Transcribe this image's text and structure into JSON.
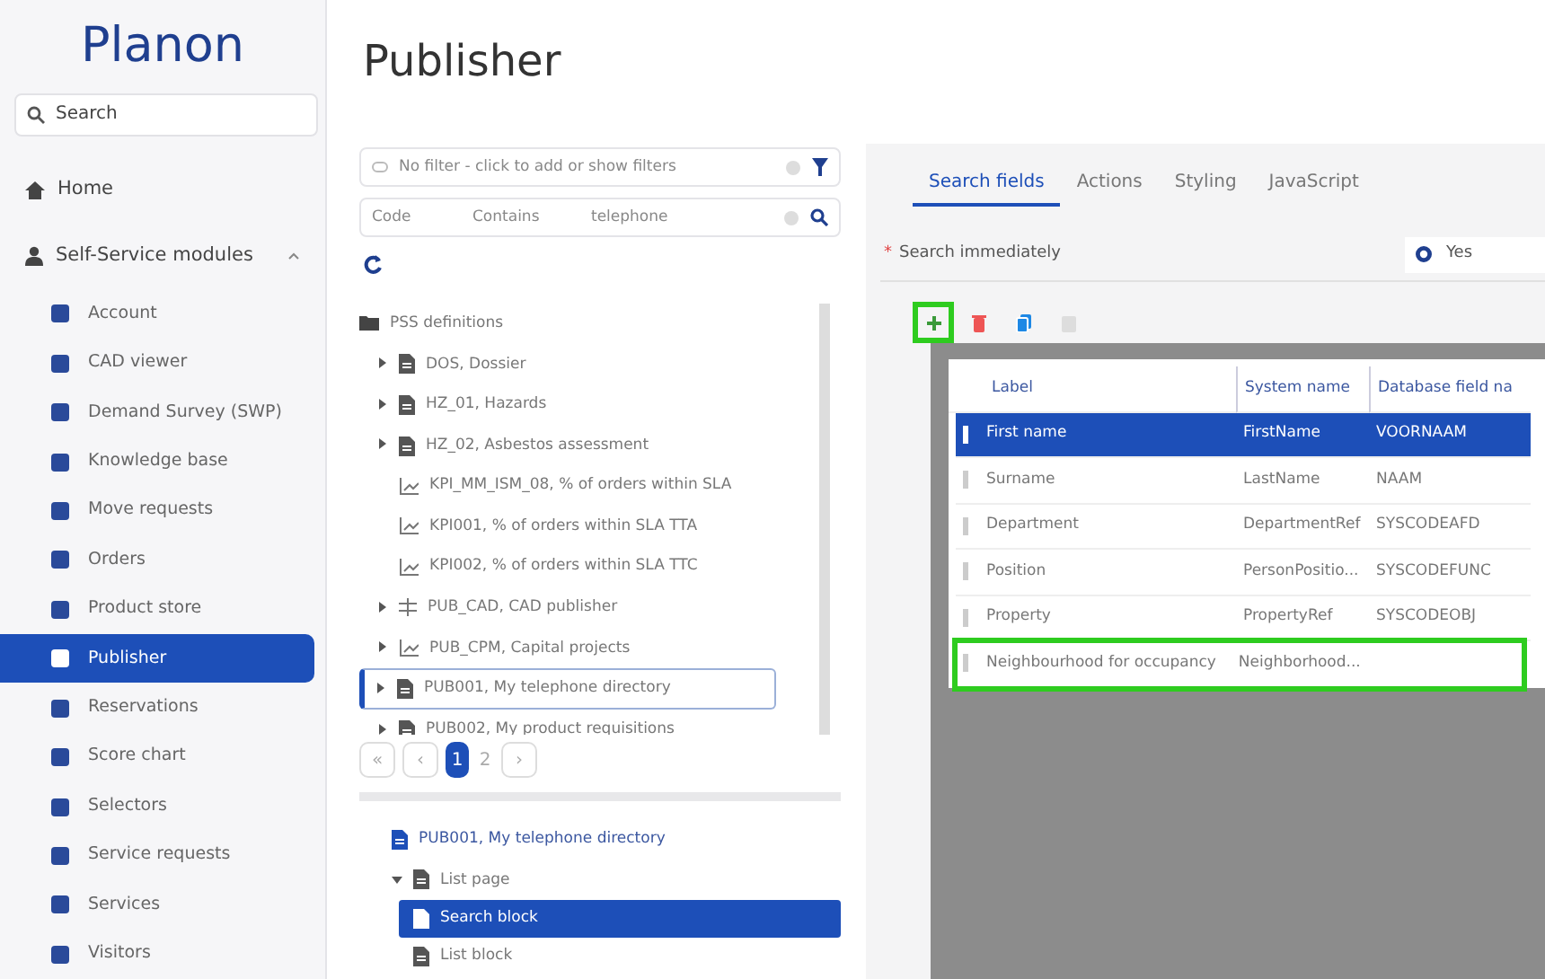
{
  "sidebar": {
    "logo": "Planon",
    "search": {
      "placeholder": "Search"
    },
    "home": "Home",
    "section": {
      "label": "Self-Service modules",
      "expanded": true,
      "items": [
        {
          "label": "Account",
          "selected": false
        },
        {
          "label": "CAD viewer",
          "selected": false
        },
        {
          "label": "Demand Survey (SWP)",
          "selected": false
        },
        {
          "label": "Knowledge base",
          "selected": false
        },
        {
          "label": "Move requests",
          "selected": false
        },
        {
          "label": "Orders",
          "selected": false
        },
        {
          "label": "Product store",
          "selected": false
        },
        {
          "label": "Publisher",
          "selected": true
        },
        {
          "label": "Reservations",
          "selected": false
        },
        {
          "label": "Score chart",
          "selected": false
        },
        {
          "label": "Selectors",
          "selected": false
        },
        {
          "label": "Service requests",
          "selected": false
        },
        {
          "label": "Services",
          "selected": false
        },
        {
          "label": "Visitors",
          "selected": false
        }
      ]
    }
  },
  "page_title": "Publisher",
  "filter": {
    "text": "No filter - click to add or show filters"
  },
  "search_row": {
    "field": "Code",
    "operator": "Contains",
    "value": "telephone"
  },
  "tree": {
    "root": "PSS definitions",
    "children": [
      {
        "label": "DOS, Dossier",
        "kind": "document",
        "expandable": true,
        "selected": false
      },
      {
        "label": "HZ_01, Hazards",
        "kind": "document",
        "expandable": true,
        "selected": false
      },
      {
        "label": "HZ_02, Asbestos assessment",
        "kind": "document",
        "expandable": true,
        "selected": false
      },
      {
        "label": "KPI_MM_ISM_08, % of orders within SLA",
        "kind": "chart",
        "expandable": false,
        "selected": false
      },
      {
        "label": "KPI001, % of orders within SLA TTA",
        "kind": "chart",
        "expandable": false,
        "selected": false
      },
      {
        "label": "KPI002, % of orders within SLA TTC",
        "kind": "chart",
        "expandable": false,
        "selected": false
      },
      {
        "label": "PUB_CAD, CAD publisher",
        "kind": "cad",
        "expandable": true,
        "selected": false
      },
      {
        "label": "PUB_CPM, Capital projects",
        "kind": "chart",
        "expandable": true,
        "selected": false
      },
      {
        "label": "PUB001, My telephone directory",
        "kind": "document",
        "expandable": true,
        "selected": true
      },
      {
        "label": "PUB002, My product requisitions",
        "kind": "document",
        "expandable": true,
        "selected": false
      }
    ]
  },
  "pagination": {
    "first": "«",
    "previous": "‹",
    "next": "›",
    "pages": [
      {
        "label": "1",
        "selected": true
      },
      {
        "label": "2",
        "selected": false
      }
    ]
  },
  "detail_tree": {
    "root": "PUB001, My telephone directory",
    "children": [
      {
        "label": "List page",
        "expanded": true,
        "children": [
          {
            "label": "Search block",
            "selected": true
          },
          {
            "label": "List block",
            "selected": false
          }
        ]
      }
    ]
  },
  "tabs": [
    {
      "label": "Search fields",
      "selected": true
    },
    {
      "label": "Actions",
      "selected": false
    },
    {
      "label": "Styling",
      "selected": false
    },
    {
      "label": "JavaScript",
      "selected": false
    }
  ],
  "search_immediately": {
    "required_mark": "*",
    "label": "Search immediately",
    "option": "Yes",
    "checked": true
  },
  "toolbar": [
    {
      "kind": "add",
      "disabled": false,
      "highlighted": true
    },
    {
      "kind": "delete",
      "disabled": false,
      "highlighted": false
    },
    {
      "kind": "copy",
      "disabled": false,
      "highlighted": false
    },
    {
      "kind": "paste",
      "disabled": true,
      "highlighted": false
    }
  ],
  "table": {
    "columns": [
      "Label",
      "System name",
      "Database field na"
    ],
    "rows": [
      {
        "cells": [
          "First name",
          "FirstName",
          "VOORNAAM"
        ],
        "selected": true,
        "highlighted": false
      },
      {
        "cells": [
          "Surname",
          "LastName",
          "NAAM"
        ],
        "selected": false,
        "highlighted": false
      },
      {
        "cells": [
          "Department",
          "DepartmentRef",
          "SYSCODEAFD"
        ],
        "selected": false,
        "highlighted": false
      },
      {
        "cells": [
          "Position",
          "PersonPositio...",
          "SYSCODEFUNC"
        ],
        "selected": false,
        "highlighted": false
      },
      {
        "cells": [
          "Property",
          "PropertyRef",
          "SYSCODEOBJ"
        ],
        "selected": false,
        "highlighted": false
      },
      {
        "cells": [
          "Neighbourhood for occupancy",
          "Neighborhood...",
          ""
        ],
        "selected": false,
        "highlighted": true
      }
    ]
  }
}
